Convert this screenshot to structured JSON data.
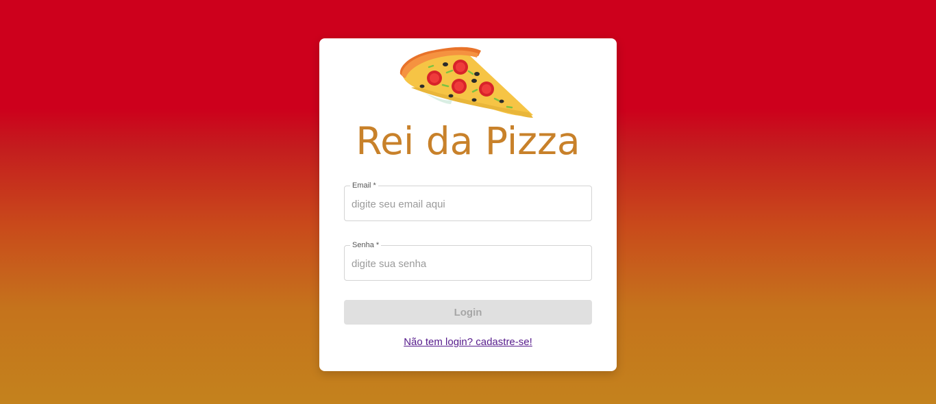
{
  "app": {
    "title": "Rei da Pizza"
  },
  "logo": {
    "icon": "pizza-slice-icon"
  },
  "form": {
    "email": {
      "label": "Email *",
      "placeholder": "digite seu email aqui",
      "value": ""
    },
    "senha": {
      "label": "Senha *",
      "placeholder": "digite sua senha",
      "value": ""
    },
    "login_label": "Login",
    "signup_link": "Não tem login? cadastre-se!"
  },
  "colors": {
    "background_top": "#cd001c",
    "background_bottom": "#c4821d",
    "title": "#c8812a",
    "link": "#551a8b",
    "button_disabled_bg": "#e0e0e0"
  }
}
